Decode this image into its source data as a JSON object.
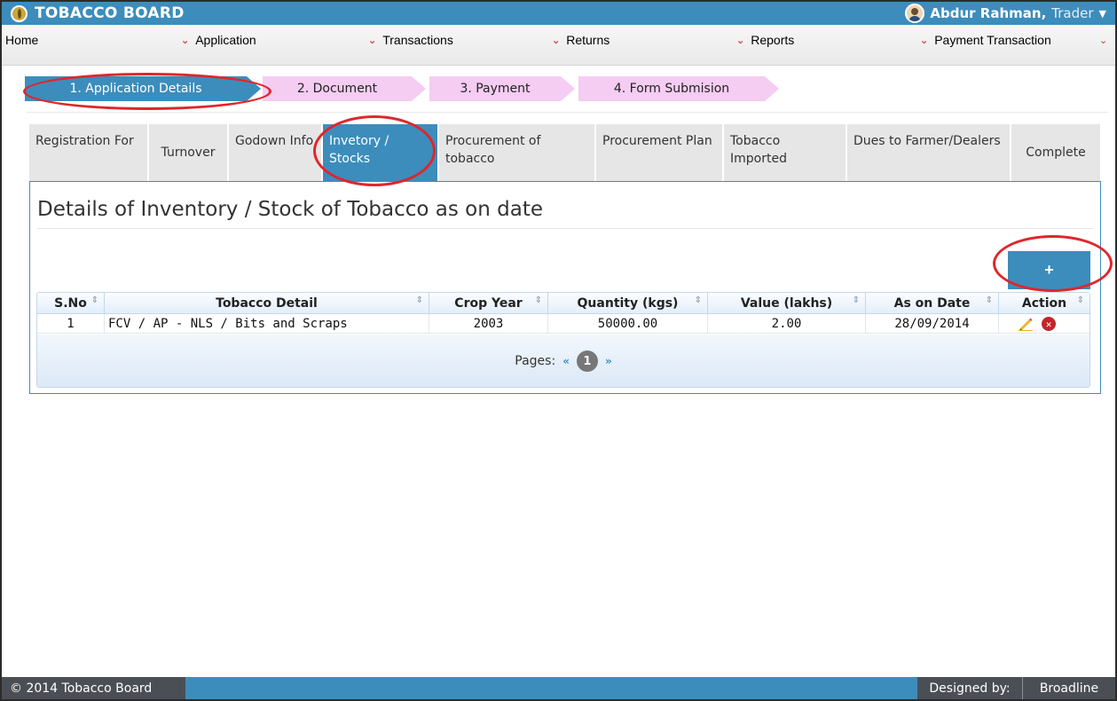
{
  "header": {
    "brand": "TOBACCO BOARD",
    "user_name": "Abdur Rahman,",
    "user_role": "Trader",
    "user_caret": "▼"
  },
  "menu": [
    {
      "label": "Home"
    },
    {
      "label": "Application"
    },
    {
      "label": "Transactions"
    },
    {
      "label": "Returns"
    },
    {
      "label": "Reports"
    },
    {
      "label": "Payment Transaction"
    }
  ],
  "steps": [
    {
      "label": "1. Application Details",
      "state": "active"
    },
    {
      "label": "2. Document",
      "state": "inactive"
    },
    {
      "label": "3. Payment",
      "state": "inactive"
    },
    {
      "label": "4. Form Submision",
      "state": "inactive"
    }
  ],
  "tabs": [
    {
      "label": "Registration For"
    },
    {
      "label": "Turnover"
    },
    {
      "label": "Godown Info"
    },
    {
      "label": "Invetory / Stocks",
      "active": true
    },
    {
      "label": "Procurement of tobacco"
    },
    {
      "label": "Procurement Plan"
    },
    {
      "label": "Tobacco Imported"
    },
    {
      "label": "Dues to Farmer/Dealers"
    },
    {
      "label": "Complete"
    }
  ],
  "panel": {
    "title": "Details of Inventory / Stock of Tobacco as on date",
    "add_button_icon": "plus-icon",
    "add_button_label": "+"
  },
  "table": {
    "columns": [
      "S.No",
      "Tobacco Detail",
      "Crop Year",
      "Quantity (kgs)",
      "Value (lakhs)",
      "As on Date",
      "Action"
    ],
    "rows": [
      {
        "sno": "1",
        "detail": "FCV / AP - NLS / Bits and Scraps",
        "crop_year": "2003",
        "quantity": "50000.00",
        "value": "2.00",
        "date": "28/09/2014"
      }
    ],
    "pager": {
      "label": "Pages:",
      "prev": "«",
      "current": "1",
      "next": "»"
    }
  },
  "footer": {
    "copyright": "© 2014 Tobacco Board",
    "designed_by": "Designed by:",
    "designer": "Broadline"
  },
  "colors": {
    "primary": "#3c8dbc",
    "step_inactive": "#f5ccf2",
    "annotation_red": "#e0262b",
    "footer_dark": "#4a4f55"
  }
}
